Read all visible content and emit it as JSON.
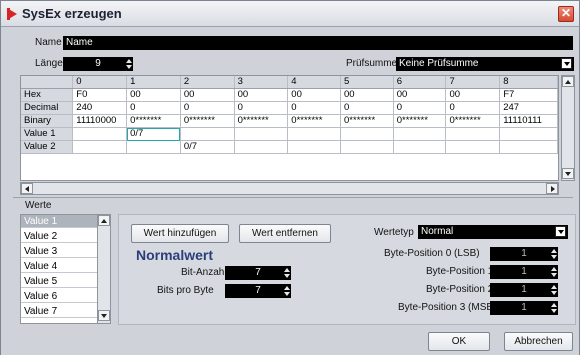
{
  "window": {
    "title": "SysEx erzeugen",
    "close_glyph": "✕"
  },
  "name_row": {
    "label": "Name",
    "value": "Name"
  },
  "length_row": {
    "label": "Länge",
    "value": "9"
  },
  "checksum": {
    "label": "Prüfsumme",
    "value": "Keine Prüfsumme"
  },
  "table": {
    "columns": [
      "",
      "0",
      "1",
      "2",
      "3",
      "4",
      "5",
      "6",
      "7",
      "8"
    ],
    "rows": [
      {
        "label": "Hex",
        "cells": [
          "F0",
          "00",
          "00",
          "00",
          "00",
          "00",
          "00",
          "00",
          "F7"
        ]
      },
      {
        "label": "Decimal",
        "cells": [
          "240",
          "0",
          "0",
          "0",
          "0",
          "0",
          "0",
          "0",
          "247"
        ]
      },
      {
        "label": "Binary",
        "cells": [
          "11110000",
          "0*******",
          "0*******",
          "0*******",
          "0*******",
          "0*******",
          "0*******",
          "0*******",
          "11110111"
        ]
      },
      {
        "label": "Value 1",
        "cells": [
          "",
          "0/7",
          "",
          "",
          "",
          "",
          "",
          "",
          ""
        ]
      },
      {
        "label": "Value 2",
        "cells": [
          "",
          "",
          "0/7",
          "",
          "",
          "",
          "",
          "",
          ""
        ]
      }
    ]
  },
  "werte": {
    "label": "Werte",
    "items": [
      "Value 1",
      "Value 2",
      "Value 3",
      "Value 4",
      "Value 5",
      "Value 6",
      "Value 7"
    ]
  },
  "buttons": {
    "add": "Wert hinzufügen",
    "remove": "Wert entfernen",
    "ok": "OK",
    "cancel": "Abbrechen"
  },
  "werttyp": {
    "label": "Wertetyp",
    "value": "Normal"
  },
  "normalwert": {
    "heading": "Normalwert",
    "bit_count_label": "Bit-Anzahl",
    "bit_count_value": "7",
    "bits_per_byte_label": "Bits pro Byte",
    "bits_per_byte_value": "7"
  },
  "byte_positions": [
    {
      "label": "Byte-Position 0 (LSB)",
      "value": "1"
    },
    {
      "label": "Byte-Position 1",
      "value": "1"
    },
    {
      "label": "Byte-Position 2",
      "value": "1"
    },
    {
      "label": "Byte-Position 3 (MSB)",
      "value": "1"
    }
  ],
  "colors": {
    "accent": "#d62525",
    "dark_field": "#000000",
    "selection_outline": "#29a6a6",
    "heading": "#2a3f7a"
  }
}
